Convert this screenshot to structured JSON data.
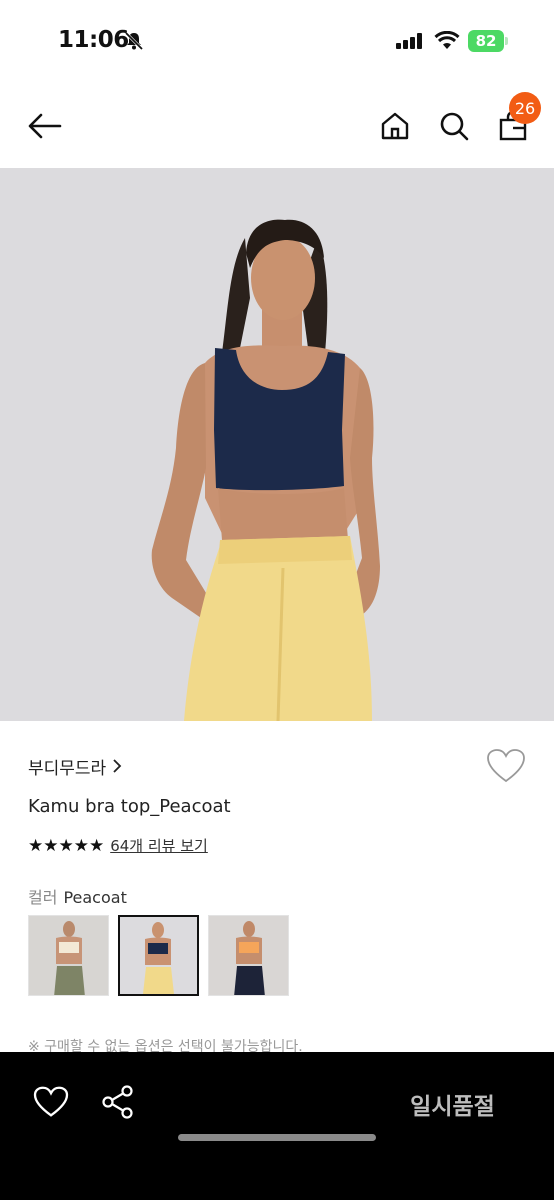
{
  "status_bar": {
    "time": "11:06",
    "battery": "82"
  },
  "nav": {
    "cart_count": "26"
  },
  "product": {
    "brand": "부디무드라",
    "name": "Kamu bra top_Peacoat",
    "stars": "★★★★★",
    "review_link": "64개 리뷰 보기",
    "color_label": "컬러",
    "color_value": "Peacoat"
  },
  "notice": "※ 구매할 수 없는 옵션은 선택이 불가능합니다.",
  "bottom": {
    "soldout_label": "일시품절"
  },
  "colors": {
    "accent": "#f25c14",
    "bar": "#000000",
    "soldout_text": "#bdbdbd"
  }
}
